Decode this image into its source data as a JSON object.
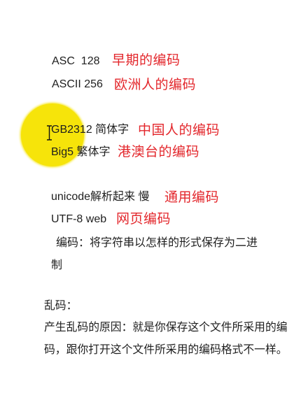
{
  "encodings": [
    {
      "label": "ASC  128",
      "note": "早期的编码"
    },
    {
      "label": "ASCII 256",
      "note": "欧洲人的编码"
    },
    {
      "label": "GB2312 简体字",
      "note": "中国人的编码"
    },
    {
      "label": "Big5 繁体字",
      "note": "港澳台的编码"
    },
    {
      "label": "unicode解析起来 慢",
      "note": "通用编码"
    },
    {
      "label": "UTF-8 web",
      "note": "网页编码"
    }
  ],
  "definition": {
    "line1": "编码：将字符串以怎样的形式保存为二进",
    "line2": "制"
  },
  "garbled": {
    "heading": "乱码：",
    "line1": "产生乱码的原因：就是你保存这个文件所采用的编",
    "line2": "码，跟你打开这个文件所采用的编码格式不一样。"
  },
  "colors": {
    "text": "#1e1e1e",
    "note": "#e3262b",
    "highlight": "#f6e40a",
    "background": "#ffffff"
  },
  "icons": {
    "cursor": "text-cursor-icon",
    "highlight": "cursor-highlight-circle"
  }
}
